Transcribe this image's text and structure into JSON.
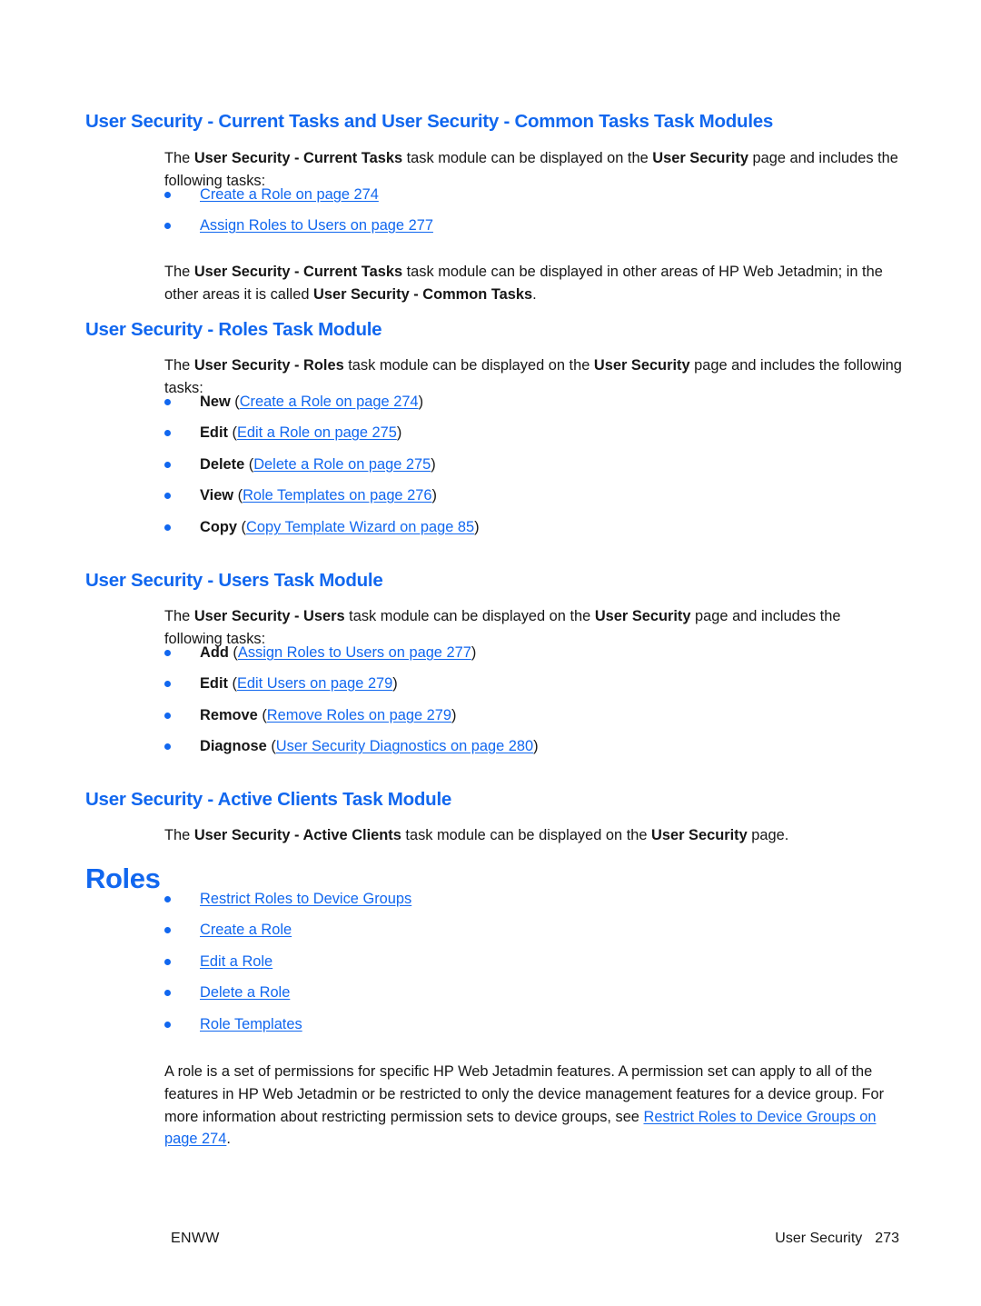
{
  "document": {
    "title": "User Security",
    "footer": {
      "left": "ENWW",
      "section": "User Security",
      "page_number": "273"
    },
    "colors": {
      "heading_blue": "#1167ef",
      "link_blue": "#1167ef",
      "body_text": "#161616",
      "page_background": "#ffffff"
    }
  },
  "sections": {
    "current_tasks": {
      "heading": "User Security - Current Tasks and User Security - Common Tasks Task Modules",
      "intro": {
        "p1": "The ",
        "b1": "User Security - Current Tasks",
        "p2": " task module can be displayed on the ",
        "b2": "User Security",
        "p3": " page and includes the following tasks:"
      },
      "links": [
        {
          "label": "Create a Role on page 274"
        },
        {
          "label": "Assign Roles to Users on page 277"
        }
      ],
      "note": {
        "p1": "The ",
        "b1": "User Security - Current Tasks",
        "p2": " task module can be displayed in other areas of HP Web Jetadmin; in the other areas it is called ",
        "b2": "User Security - Common Tasks",
        "p3": "."
      }
    },
    "roles_task_module": {
      "heading": "User Security - Roles Task Module",
      "intro": {
        "p1": "The ",
        "b1": "User Security - Roles",
        "p2": " task module can be displayed on the ",
        "b2": "User Security",
        "p3": " page and includes the following tasks:"
      },
      "items": [
        {
          "lead": "New",
          "open": " (",
          "link": "Create a Role on page 274",
          "close": ")"
        },
        {
          "lead": "Edit",
          "open": " (",
          "link": "Edit a Role on page 275",
          "close": ")"
        },
        {
          "lead": "Delete",
          "open": " (",
          "link": "Delete a Role on page 275",
          "close": ")"
        },
        {
          "lead": "View",
          "open": " (",
          "link": "Role Templates on page 276",
          "close": ")"
        },
        {
          "lead": "Copy",
          "open": " (",
          "link": "Copy Template Wizard on page 85",
          "close": ")"
        }
      ]
    },
    "users_task_module": {
      "heading": "User Security - Users Task Module",
      "intro": {
        "p1": "The ",
        "b1": "User Security - Users",
        "p2": " task module can be displayed on the ",
        "b2": "User Security",
        "p3": " page and includes the following tasks:"
      },
      "items": [
        {
          "lead": "Add",
          "open": " (",
          "link": "Assign Roles to Users on page 277",
          "close": ")"
        },
        {
          "lead": "Edit",
          "open": " (",
          "link": "Edit Users on page 279",
          "close": ")"
        },
        {
          "lead": "Remove",
          "open": " (",
          "link": "Remove Roles on page 279",
          "close": ")"
        },
        {
          "lead": "Diagnose",
          "open": " (",
          "link": "User Security Diagnostics on page 280",
          "close": ")"
        }
      ]
    },
    "active_clients_task_module": {
      "heading": "User Security - Active Clients Task Module",
      "intro": {
        "p1": "The ",
        "b1": "User Security - Active Clients",
        "p2": " task module can be displayed on the ",
        "b2": "User Security",
        "p3": " page."
      }
    },
    "roles_chapter": {
      "heading": "Roles",
      "links": [
        {
          "label": "Restrict Roles to Device Groups"
        },
        {
          "label": "Create a Role"
        },
        {
          "label": "Edit a Role"
        },
        {
          "label": "Delete a Role"
        },
        {
          "label": "Role Templates"
        }
      ],
      "body": {
        "p1": "A role is a set of permissions for specific HP Web Jetadmin features. A permission set can apply to all of the features in HP Web Jetadmin or be restricted to only the device management features for a device group. For more information about restricting permission sets to device groups, see ",
        "link": "Restrict Roles to Device Groups on page 274",
        "p2": "."
      }
    }
  }
}
